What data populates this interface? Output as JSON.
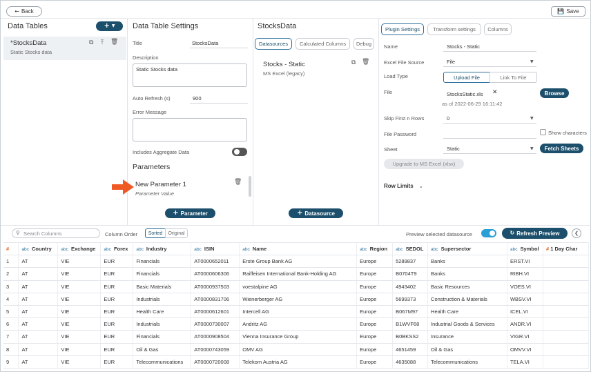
{
  "topbar": {
    "back_label": "Back",
    "save_label": "Save"
  },
  "data_tables": {
    "title": "Data Tables",
    "item_name": "*StocksData",
    "item_desc": "Static Stocks data"
  },
  "settings": {
    "title": "Data Table Settings",
    "title_label": "Title",
    "title_value": "StocksData",
    "description_label": "Description",
    "description_value": "Static Stocks data",
    "auto_refresh_label": "Auto Refresh (s)",
    "auto_refresh_value": "900",
    "error_label": "Error Message",
    "aggregate_label": "Includes Aggregate Data",
    "parameters_title": "Parameters",
    "param_name": "New Parameter 1",
    "param_value": "Parameter Value",
    "add_param_label": "Parameter"
  },
  "datasources": {
    "title": "StocksData",
    "tabs": [
      "Datasources",
      "Calculated Columns",
      "Debug"
    ],
    "item_name": "Stocks - Static",
    "item_type": "MS Excel (legacy)",
    "add_label": "Datasource"
  },
  "plugin": {
    "tabs": [
      "Plugin Settings",
      "Transform settings",
      "Columns"
    ],
    "name_label": "Name",
    "name_value": "Stocks - Static",
    "source_label": "Excel File Source",
    "source_value": "File",
    "load_type_label": "Load Type",
    "load_upload": "Upload File",
    "load_link": "Link To File",
    "file_label": "File",
    "file_name": "StocksStatic.xls",
    "file_date": "as of 2022-06-29 16:11:42",
    "browse_label": "Browse",
    "skip_label": "Skip First n Rows",
    "skip_value": "0",
    "password_label": "File Password",
    "show_chars_label": "Show characters",
    "sheet_label": "Sheet",
    "sheet_value": "Static",
    "fetch_label": "Fetch Sheets",
    "upgrade_label": "Upgrade to MS Excel (xlsx)",
    "row_limits_label": "Row Limits"
  },
  "preview": {
    "search_placeholder": "Search Columns",
    "column_order_label": "Column Order",
    "sorted_label": "Sorted",
    "original_label": "Original",
    "preview_label": "Preview selected datasource",
    "refresh_label": "Refresh Preview"
  },
  "table": {
    "columns": [
      {
        "type": "#",
        "name": ""
      },
      {
        "type": "abc",
        "name": "Country"
      },
      {
        "type": "abc",
        "name": "Exchange"
      },
      {
        "type": "abc",
        "name": "Forex"
      },
      {
        "type": "abc",
        "name": "Industry"
      },
      {
        "type": "abc",
        "name": "ISIN"
      },
      {
        "type": "abc",
        "name": "Name"
      },
      {
        "type": "abc",
        "name": "Region"
      },
      {
        "type": "abc",
        "name": "SEDOL"
      },
      {
        "type": "abc",
        "name": "Supersector"
      },
      {
        "type": "abc",
        "name": "Symbol"
      },
      {
        "type": "#",
        "name": "1 Day Char"
      }
    ],
    "rows": [
      [
        "1",
        "AT",
        "VIE",
        "EUR",
        "Financials",
        "AT0000652011",
        "Erste Group Bank AG",
        "Europe",
        "5289837",
        "Banks",
        "ERST.VI",
        ""
      ],
      [
        "2",
        "AT",
        "VIE",
        "EUR",
        "Financials",
        "AT0000606306",
        "Raiffeisen International Bank-Holding AG",
        "Europe",
        "B0704T9",
        "Banks",
        "RIBH.VI",
        ""
      ],
      [
        "3",
        "AT",
        "VIE",
        "EUR",
        "Basic Materials",
        "AT0000937503",
        "voestalpine AG",
        "Europe",
        "4943402",
        "Basic Resources",
        "VOES.VI",
        ""
      ],
      [
        "4",
        "AT",
        "VIE",
        "EUR",
        "Industrials",
        "AT0000831706",
        "Wienerberger AG",
        "Europe",
        "5699373",
        "Construction & Materials",
        "WBSV.VI",
        ""
      ],
      [
        "5",
        "AT",
        "VIE",
        "EUR",
        "Health Care",
        "AT0000612601",
        "Intercell AG",
        "Europe",
        "B067M97",
        "Health Care",
        "ICEL.VI",
        ""
      ],
      [
        "6",
        "AT",
        "VIE",
        "EUR",
        "Industrials",
        "AT0000730007",
        "Andritz AG",
        "Europe",
        "B1WVF68",
        "Industrial Goods & Services",
        "ANDR.VI",
        ""
      ],
      [
        "7",
        "AT",
        "VIE",
        "EUR",
        "Financials",
        "AT0000908504",
        "Vienna Insurance Group",
        "Europe",
        "B0BKSS2",
        "Insurance",
        "VIGR.VI",
        ""
      ],
      [
        "8",
        "AT",
        "VIE",
        "EUR",
        "Oil & Gas",
        "AT0000743059",
        "OMV AG",
        "Europe",
        "4651459",
        "Oil & Gas",
        "OMVV.VI",
        ""
      ],
      [
        "9",
        "AT",
        "VIE",
        "EUR",
        "Telecommunications",
        "AT0000720008",
        "Telekom Austria AG",
        "Europe",
        "4635088",
        "Telecommunications",
        "TELA.VI",
        ""
      ]
    ]
  },
  "colors": {
    "accent": "#1c4f6b",
    "toggle_on": "#2a9fd6",
    "arrow": "#ef5a24"
  }
}
